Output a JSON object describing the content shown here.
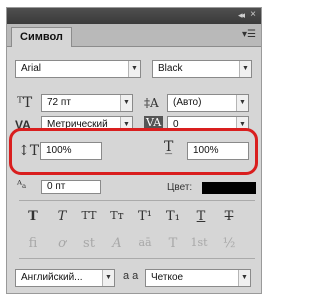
{
  "panel": {
    "tab_label": "Символ",
    "collapse_glyph": "◂◂",
    "close_glyph": "×",
    "menu_glyph": "▾☰"
  },
  "row1": {
    "font_family": "Arial",
    "font_style": "Black"
  },
  "row2": {
    "font_size": "72 пт",
    "leading": "(Авто)"
  },
  "row3": {
    "kerning": "Метрический",
    "tracking": "0"
  },
  "row4": {
    "vertical_scale": "100%",
    "horizontal_scale": "100%"
  },
  "row5": {
    "baseline_partial": "0 пт",
    "color_label": "Цвет:"
  },
  "type_buttons": [
    "T",
    "T",
    "TT",
    "Tт",
    "T¹",
    "T₁",
    "T",
    "T"
  ],
  "opentype_buttons": [
    "fi",
    "ơ",
    "st",
    "A",
    "aā",
    "T",
    "1st",
    "½"
  ],
  "bottom": {
    "language": "Английский...",
    "aa_label": "a a",
    "antialias": "Четкое"
  },
  "colors": {
    "highlight": "#d91e1e",
    "panel_bg": "#d6d6d6"
  }
}
